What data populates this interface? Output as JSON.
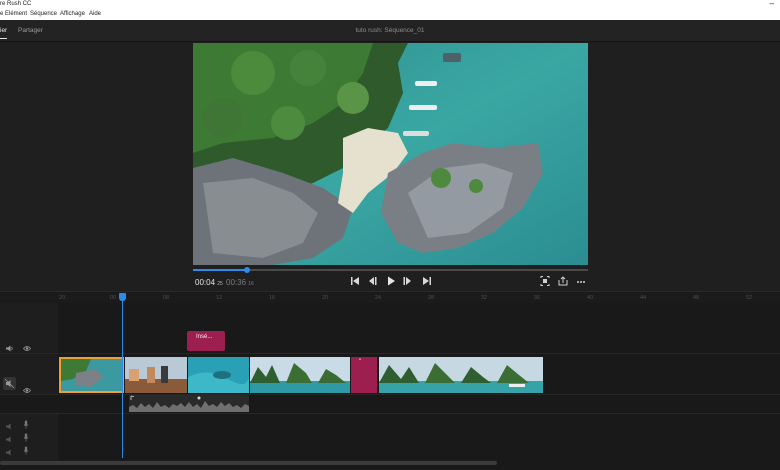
{
  "window": {
    "title": "re Rush CC",
    "minimize_glyph": "–"
  },
  "menu": {
    "items": [
      "Elément",
      "Séquence",
      "Affichage",
      "Aide"
    ],
    "first_partial": "e"
  },
  "header": {
    "tabs": [
      {
        "label": "ier",
        "active": true
      },
      {
        "label": "Partager",
        "active": false
      }
    ],
    "sequence_name": "tuto rush: Séquence_01"
  },
  "monitor": {
    "playback_progress": 0.137,
    "timecode": "00:04",
    "timecode_frames": "25",
    "duration": "00:36",
    "duration_frames": "16",
    "controls": [
      {
        "name": "go-to-start-icon"
      },
      {
        "name": "step-back-icon"
      },
      {
        "name": "play-icon"
      },
      {
        "name": "step-forward-icon"
      },
      {
        "name": "go-to-end-icon"
      },
      {
        "name": "fit-frame-icon"
      },
      {
        "name": "export-frame-icon"
      },
      {
        "name": "more-options-icon"
      }
    ]
  },
  "ruler": {
    "ticks": [
      "20",
      "00",
      "08",
      "12",
      "16",
      "20",
      "24",
      "28",
      "32",
      "36",
      "40",
      "44",
      "48",
      "52"
    ]
  },
  "timeline": {
    "title_clip_label": "Insé...",
    "magenta_clip_label": "\"",
    "playhead_seconds": 4.25,
    "colors": {
      "accent": "#2d8ceb",
      "selection": "#f0a030",
      "title_clip": "#9c1f4f"
    }
  }
}
